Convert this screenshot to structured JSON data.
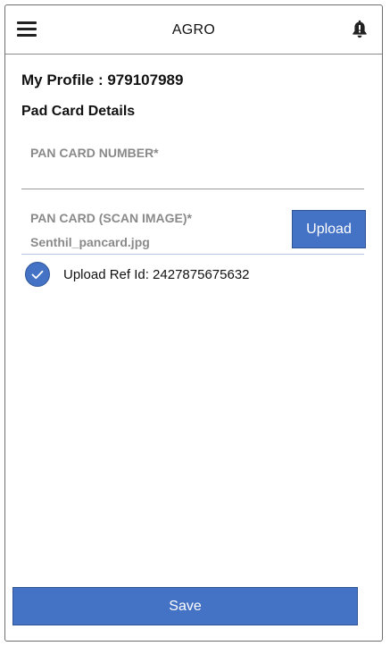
{
  "appbar": {
    "title": "AGRO",
    "menu_icon": "hamburger-menu-icon",
    "notification_icon": "bell-icon"
  },
  "profile": {
    "title": "My Profile : 979107989"
  },
  "pan_section": {
    "title": "Pad Card Details",
    "pan_number_label": "PAN CARD NUMBER*",
    "pan_number_value": "",
    "scan_label": "PAN CARD (SCAN IMAGE)*",
    "file_name": "Senthil_pancard.jpg",
    "upload_label": "Upload",
    "upload_status_icon": "check-circle-icon",
    "upload_ref_text": "Upload Ref Id: 2427875675632"
  },
  "footer": {
    "save_label": "Save"
  },
  "colors": {
    "primary": "#4472c4",
    "label_gray": "#8a8a8a",
    "border": "#6f6f6f"
  }
}
